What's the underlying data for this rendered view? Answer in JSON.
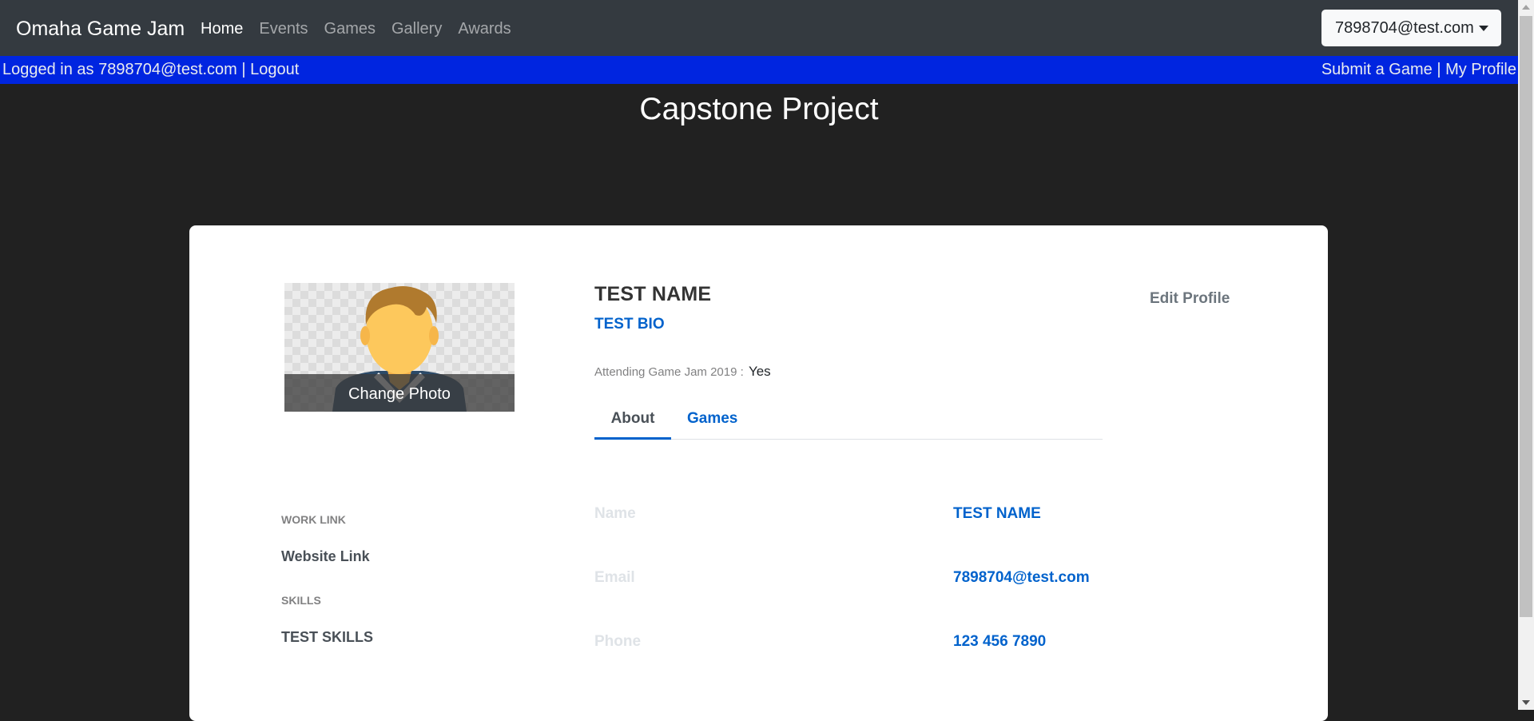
{
  "navbar": {
    "brand": "Omaha Game Jam",
    "links": [
      "Home",
      "Events",
      "Games",
      "Gallery",
      "Awards"
    ],
    "active_link": "Home",
    "user_menu": "7898704@test.com"
  },
  "status_bar": {
    "left_text": "Logged in as 7898704@test.com | Logout",
    "right_text": "Submit a Game | My Profile"
  },
  "page_title": "Capstone Project",
  "profile": {
    "change_photo_label": "Change Photo",
    "name": "TEST NAME",
    "bio": "TEST BIO",
    "attending_label": "Attending Game Jam 2019 :",
    "attending_value": "Yes",
    "edit_profile_label": "Edit Profile",
    "tabs": [
      "About",
      "Games"
    ],
    "active_tab": "About",
    "work_link_label": "WORK LINK",
    "work_link_value": "Website Link",
    "skills_label": "SKILLS",
    "skills_value": "TEST SKILLS",
    "about": [
      {
        "label": "Name",
        "value": "TEST NAME"
      },
      {
        "label": "Email",
        "value": "7898704@test.com"
      },
      {
        "label": "Phone",
        "value": "123 456 7890"
      }
    ]
  },
  "colors": {
    "navbar_bg": "#343a40",
    "status_bar_bg": "#0025e0",
    "page_bg": "#212121",
    "accent": "#0062cc"
  },
  "icons": {
    "avatar": "person-avatar-icon",
    "dropdown": "caret-down-icon"
  }
}
